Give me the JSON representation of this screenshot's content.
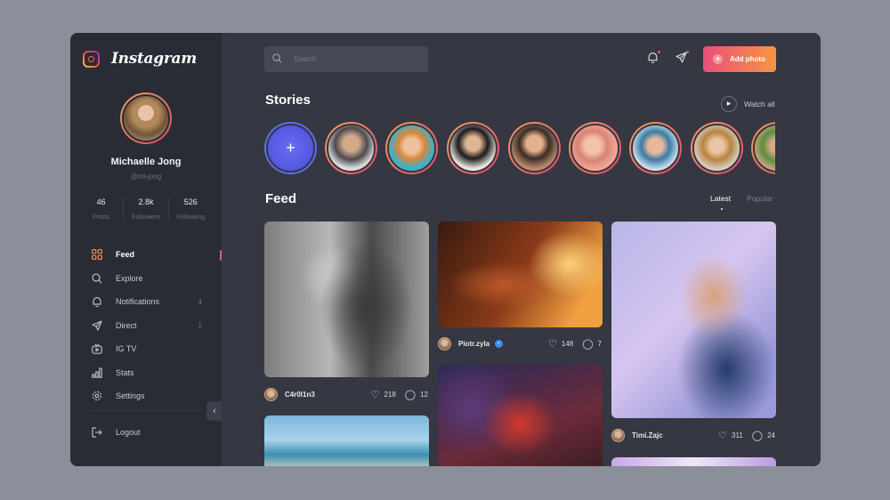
{
  "app": {
    "title": "Instagram"
  },
  "profile": {
    "name": "Michaelle Jong",
    "handle": "@mi-jong",
    "stats": [
      {
        "value": "46",
        "label": "Posts"
      },
      {
        "value": "2.8k",
        "label": "Followers"
      },
      {
        "value": "526",
        "label": "Following"
      }
    ]
  },
  "nav": {
    "items": [
      {
        "label": "Feed",
        "icon": "grid-icon",
        "count": ""
      },
      {
        "label": "Explore",
        "icon": "search-icon",
        "count": ""
      },
      {
        "label": "Notifications",
        "icon": "bell-icon",
        "count": "4"
      },
      {
        "label": "Direct",
        "icon": "send-icon",
        "count": "1"
      },
      {
        "label": "IG TV",
        "icon": "tv-icon",
        "count": ""
      },
      {
        "label": "Stats",
        "icon": "stats-icon",
        "count": ""
      },
      {
        "label": "Settings",
        "icon": "gear-icon",
        "count": ""
      }
    ],
    "logout": "Logout"
  },
  "header": {
    "search_placeholder": "Search",
    "add_photo": "Add photo"
  },
  "stories": {
    "title": "Stories",
    "watch_all": "Watch all"
  },
  "feed": {
    "title": "Feed",
    "tabs": [
      "Latest",
      "Popular"
    ],
    "posts": [
      {
        "user": "C4r0l1n3",
        "likes": "218",
        "comments": "12",
        "verified": false
      },
      {
        "user": "Piotr.zyla",
        "likes": "148",
        "comments": "7",
        "verified": true
      },
      {
        "user": "Timi.Zajc",
        "likes": "311",
        "comments": "24",
        "verified": false
      }
    ]
  },
  "colors": {
    "accent_start": "#ea4f7a",
    "accent_end": "#f79543",
    "sidebar_bg": "#2a2c35",
    "main_bg": "#353742"
  }
}
